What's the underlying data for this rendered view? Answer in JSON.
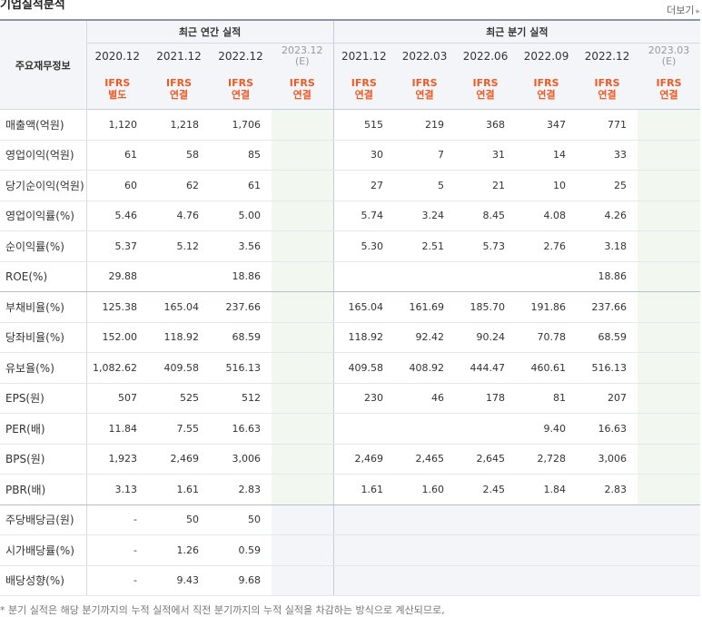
{
  "header": {
    "title": "기업실적분석",
    "more_label": "더보기",
    "more_icon": "triangle-right-icon"
  },
  "table": {
    "row_header_title": "주요재무정보",
    "group_annual": "최근 연간 실적",
    "group_quarter": "최근 분기 실적",
    "periods": [
      {
        "label": "2020.12",
        "sub": "",
        "ifrs1": "IFRS",
        "ifrs2": "별도",
        "est": false
      },
      {
        "label": "2021.12",
        "sub": "",
        "ifrs1": "IFRS",
        "ifrs2": "연결",
        "est": false
      },
      {
        "label": "2022.12",
        "sub": "",
        "ifrs1": "IFRS",
        "ifrs2": "연결",
        "est": false
      },
      {
        "label": "2023.12",
        "sub": "(E)",
        "ifrs1": "IFRS",
        "ifrs2": "연결",
        "est": true
      },
      {
        "label": "2021.12",
        "sub": "",
        "ifrs1": "IFRS",
        "ifrs2": "연결",
        "est": false
      },
      {
        "label": "2022.03",
        "sub": "",
        "ifrs1": "IFRS",
        "ifrs2": "연결",
        "est": false
      },
      {
        "label": "2022.06",
        "sub": "",
        "ifrs1": "IFRS",
        "ifrs2": "연결",
        "est": false
      },
      {
        "label": "2022.09",
        "sub": "",
        "ifrs1": "IFRS",
        "ifrs2": "연결",
        "est": false
      },
      {
        "label": "2022.12",
        "sub": "",
        "ifrs1": "IFRS",
        "ifrs2": "연결",
        "est": false
      },
      {
        "label": "2023.03",
        "sub": "(E)",
        "ifrs1": "IFRS",
        "ifrs2": "연결",
        "est": true
      }
    ],
    "rows": [
      {
        "label": "매출액(억원)",
        "values": [
          "1,120",
          "1,218",
          "1,706",
          "",
          "515",
          "219",
          "368",
          "347",
          "771",
          ""
        ]
      },
      {
        "label": "영업이익(억원)",
        "values": [
          "61",
          "58",
          "85",
          "",
          "30",
          "7",
          "31",
          "14",
          "33",
          ""
        ]
      },
      {
        "label": "당기순이익(억원)",
        "values": [
          "60",
          "62",
          "61",
          "",
          "27",
          "5",
          "21",
          "10",
          "25",
          ""
        ]
      },
      {
        "label": "영업이익률(%)",
        "values": [
          "5.46",
          "4.76",
          "5.00",
          "",
          "5.74",
          "3.24",
          "8.45",
          "4.08",
          "4.26",
          ""
        ]
      },
      {
        "label": "순이익률(%)",
        "values": [
          "5.37",
          "5.12",
          "3.56",
          "",
          "5.30",
          "2.51",
          "5.73",
          "2.76",
          "3.18",
          ""
        ]
      },
      {
        "label": "ROE(%)",
        "values": [
          "29.88",
          "",
          "18.86",
          "",
          "",
          "",
          "",
          "",
          "18.86",
          ""
        ]
      },
      {
        "label": "부채비율(%)",
        "values": [
          "125.38",
          "165.04",
          "237.66",
          "",
          "165.04",
          "161.69",
          "185.70",
          "191.86",
          "237.66",
          ""
        ]
      },
      {
        "label": "당좌비율(%)",
        "values": [
          "152.00",
          "118.92",
          "68.59",
          "",
          "118.92",
          "92.42",
          "90.24",
          "70.78",
          "68.59",
          ""
        ]
      },
      {
        "label": "유보율(%)",
        "values": [
          "1,082.62",
          "409.58",
          "516.13",
          "",
          "409.58",
          "408.92",
          "444.47",
          "460.61",
          "516.13",
          ""
        ]
      },
      {
        "label": "EPS(원)",
        "values": [
          "507",
          "525",
          "512",
          "",
          "230",
          "46",
          "178",
          "81",
          "207",
          ""
        ]
      },
      {
        "label": "PER(배)",
        "values": [
          "11.84",
          "7.55",
          "16.63",
          "",
          "",
          "",
          "",
          "9.40",
          "16.63",
          ""
        ]
      },
      {
        "label": "BPS(원)",
        "values": [
          "1,923",
          "2,469",
          "3,006",
          "",
          "2,469",
          "2,465",
          "2,645",
          "2,728",
          "3,006",
          ""
        ]
      },
      {
        "label": "PBR(배)",
        "values": [
          "3.13",
          "1.61",
          "2.83",
          "",
          "1.61",
          "1.60",
          "2.45",
          "1.84",
          "2.83",
          ""
        ]
      },
      {
        "label": "주당배당금(원)",
        "values": [
          "-",
          "50",
          "50",
          "",
          "",
          "",
          "",
          "",
          "",
          ""
        ]
      },
      {
        "label": "시가배당률(%)",
        "values": [
          "-",
          "1.26",
          "0.59",
          "",
          "",
          "",
          "",
          "",
          "",
          ""
        ]
      },
      {
        "label": "배당성향(%)",
        "values": [
          "-",
          "9.43",
          "9.68",
          "",
          "",
          "",
          "",
          "",
          "",
          ""
        ]
      }
    ]
  },
  "footnote": "* 분기 실적은 해당 분기까지의 누적 실적에서 직전 분기까지의 누적 실적을 차감하는 방식으로 계산되므로,"
}
